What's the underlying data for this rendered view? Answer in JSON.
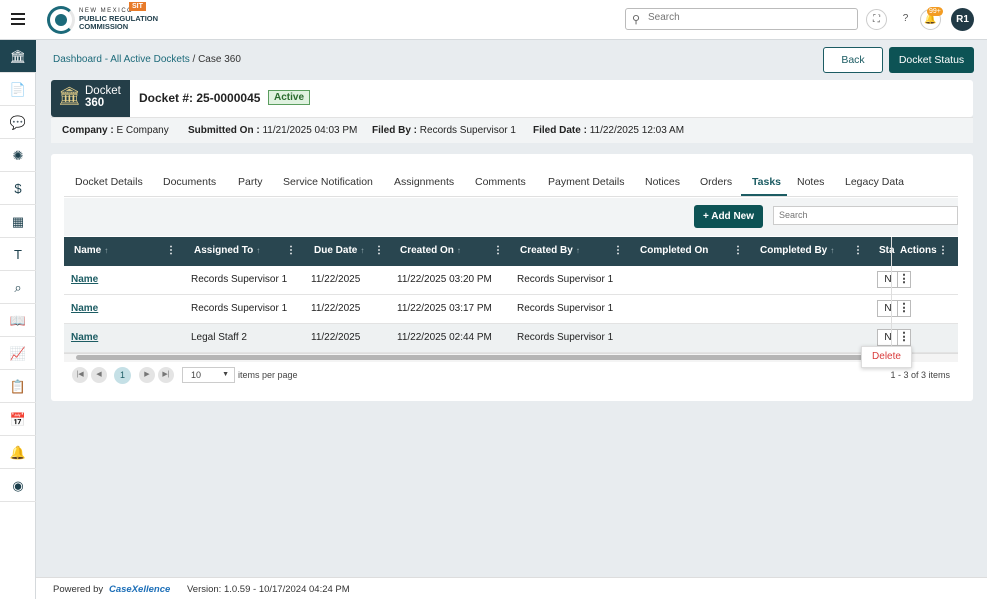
{
  "brand": {
    "line1": "NEW MEXICO",
    "line2": "PUBLIC REGULATION",
    "line3": "COMMISSION",
    "env": "SIT"
  },
  "topbar": {
    "search_placeholder": "Search",
    "notif_badge": "99+",
    "user_initials": "R1"
  },
  "breadcrumb": {
    "link": "Dashboard - All Active Dockets",
    "sep": " / ",
    "current": "Case 360"
  },
  "buttons": {
    "back": "Back",
    "docket_status": "Docket Status",
    "add_new": "+ Add New"
  },
  "docket": {
    "badge_l1": "Docket",
    "badge_l2": "360",
    "title": "Docket #: 25-0000045",
    "status": "Active"
  },
  "meta": {
    "company_label": "Company :",
    "company": "E Company",
    "submitted_label": "Submitted On :",
    "submitted": "11/21/2025 04:03 PM",
    "filed_by_label": "Filed By :",
    "filed_by": "Records Supervisor 1",
    "filed_date_label": "Filed Date :",
    "filed_date": "11/22/2025 12:03 AM"
  },
  "tabs": [
    "Docket Details",
    "Documents",
    "Party",
    "Service Notification",
    "Assignments",
    "Comments",
    "Payment Details",
    "Notices",
    "Orders",
    "Tasks",
    "Notes",
    "Legacy Data"
  ],
  "grid": {
    "search_placeholder": "Search",
    "columns": [
      "Name",
      "Assigned To",
      "Due Date",
      "Created On",
      "Created By",
      "Completed On",
      "Completed By",
      "Sta",
      "Actions"
    ],
    "rows": [
      {
        "name": "Name",
        "assigned": "Records Supervisor 1",
        "due": "11/22/2025",
        "created_on": "11/22/2025 03:20 PM",
        "created_by": "Records Supervisor 1",
        "status": "N"
      },
      {
        "name": "Name",
        "assigned": "Records Supervisor 1",
        "due": "11/22/2025",
        "created_on": "11/22/2025 03:17 PM",
        "created_by": "Records Supervisor 1",
        "status": "N"
      },
      {
        "name": "Name",
        "assigned": "Legal Staff 2",
        "due": "11/22/2025",
        "created_on": "11/22/2025 02:44 PM",
        "created_by": "Records Supervisor 1",
        "status": "N"
      }
    ],
    "menu_delete": "Delete"
  },
  "pager": {
    "current": "1",
    "page_size": "10",
    "items_label": "items per page",
    "info": "1 - 3 of 3 items"
  },
  "footer": {
    "powered": "Powered by",
    "brand": "CaseXellence",
    "version": "Version: 1.0.59 - 10/17/2024 04:24 PM"
  },
  "sidebar_icons": [
    "bank-icon",
    "document-icon",
    "chat-icon",
    "gear-burst-icon",
    "dollar-doc-icon",
    "building-icon",
    "t-box-icon",
    "search-scan-icon",
    "book-icon",
    "chart-icon",
    "clipboard-icon",
    "calendar-icon",
    "bell-icon",
    "user-circle-icon"
  ]
}
